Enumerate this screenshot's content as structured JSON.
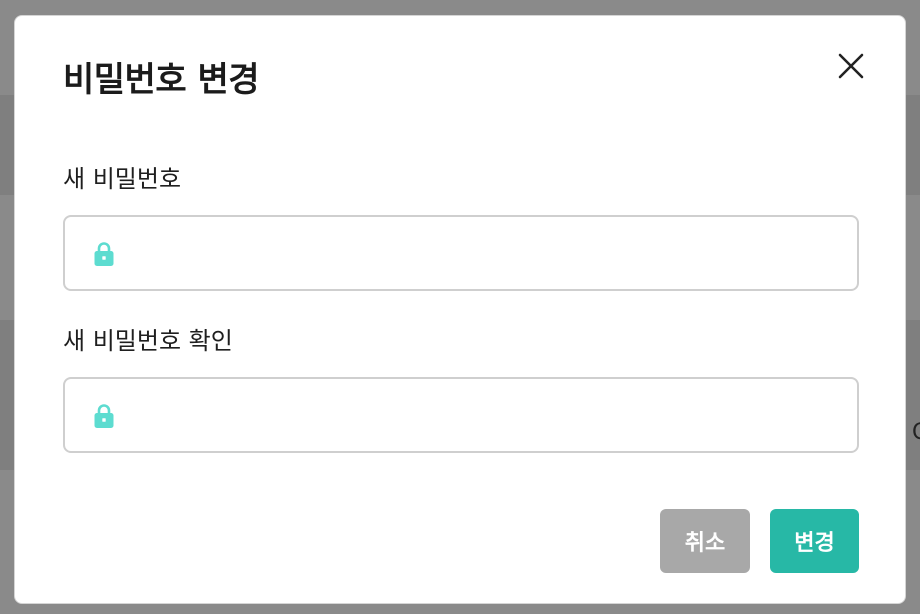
{
  "background": {
    "partial_text": "C"
  },
  "modal": {
    "title": "비밀번호 변경",
    "close_icon": "close-icon",
    "fields": [
      {
        "label": "새 비밀번호",
        "value": "",
        "placeholder": "",
        "icon": "lock-icon"
      },
      {
        "label": "새 비밀번호 확인",
        "value": "",
        "placeholder": "",
        "icon": "lock-icon"
      }
    ],
    "buttons": {
      "cancel_label": "취소",
      "confirm_label": "변경"
    }
  },
  "colors": {
    "accent": "#27b8a6",
    "lock_icon": "#5ddcd0",
    "cancel_button": "#a8a8a8",
    "overlay": "#8a8a8a"
  }
}
